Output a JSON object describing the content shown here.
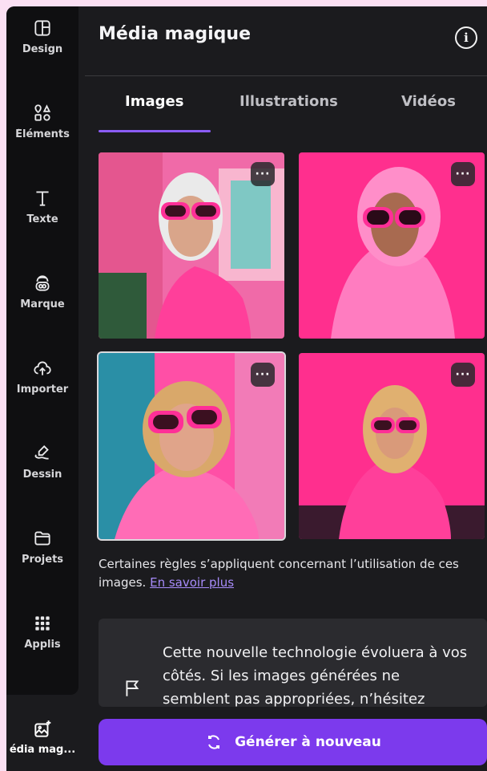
{
  "sidebar": {
    "items": [
      {
        "label": "Design",
        "icon": "layout-icon"
      },
      {
        "label": "Éléments",
        "icon": "elements-icon"
      },
      {
        "label": "Texte",
        "icon": "text-icon"
      },
      {
        "label": "Marque",
        "icon": "brand-icon"
      },
      {
        "label": "Importer",
        "icon": "upload-cloud-icon"
      },
      {
        "label": "Dessin",
        "icon": "draw-icon"
      },
      {
        "label": "Projets",
        "icon": "folder-icon"
      },
      {
        "label": "Applis",
        "icon": "apps-grid-icon"
      }
    ],
    "active": {
      "label": "édia mag...",
      "icon": "magic-media-icon"
    }
  },
  "panel": {
    "title": "Média magique",
    "info_icon": "info-icon",
    "tabs": [
      {
        "label": "Images",
        "active": true
      },
      {
        "label": "Illustrations",
        "active": false
      },
      {
        "label": "Vidéos",
        "active": false
      }
    ],
    "more_label": "···",
    "rules_text": "Certaines règles s’appliquent concernant l’utilisation de ces images.",
    "rules_link": "En savoir plus",
    "notice_text": "Cette nouvelle technologie évoluera à vos côtés. Si les images générées ne semblent pas appropriées, n’hésitez",
    "generate_label": "Générer à nouveau"
  },
  "colors": {
    "accent": "#7c3aed",
    "link": "#a78bfa",
    "panel_bg": "#1b1b1e",
    "rail_bg": "#0f0f11",
    "page_bg": "#fbe0f3"
  }
}
